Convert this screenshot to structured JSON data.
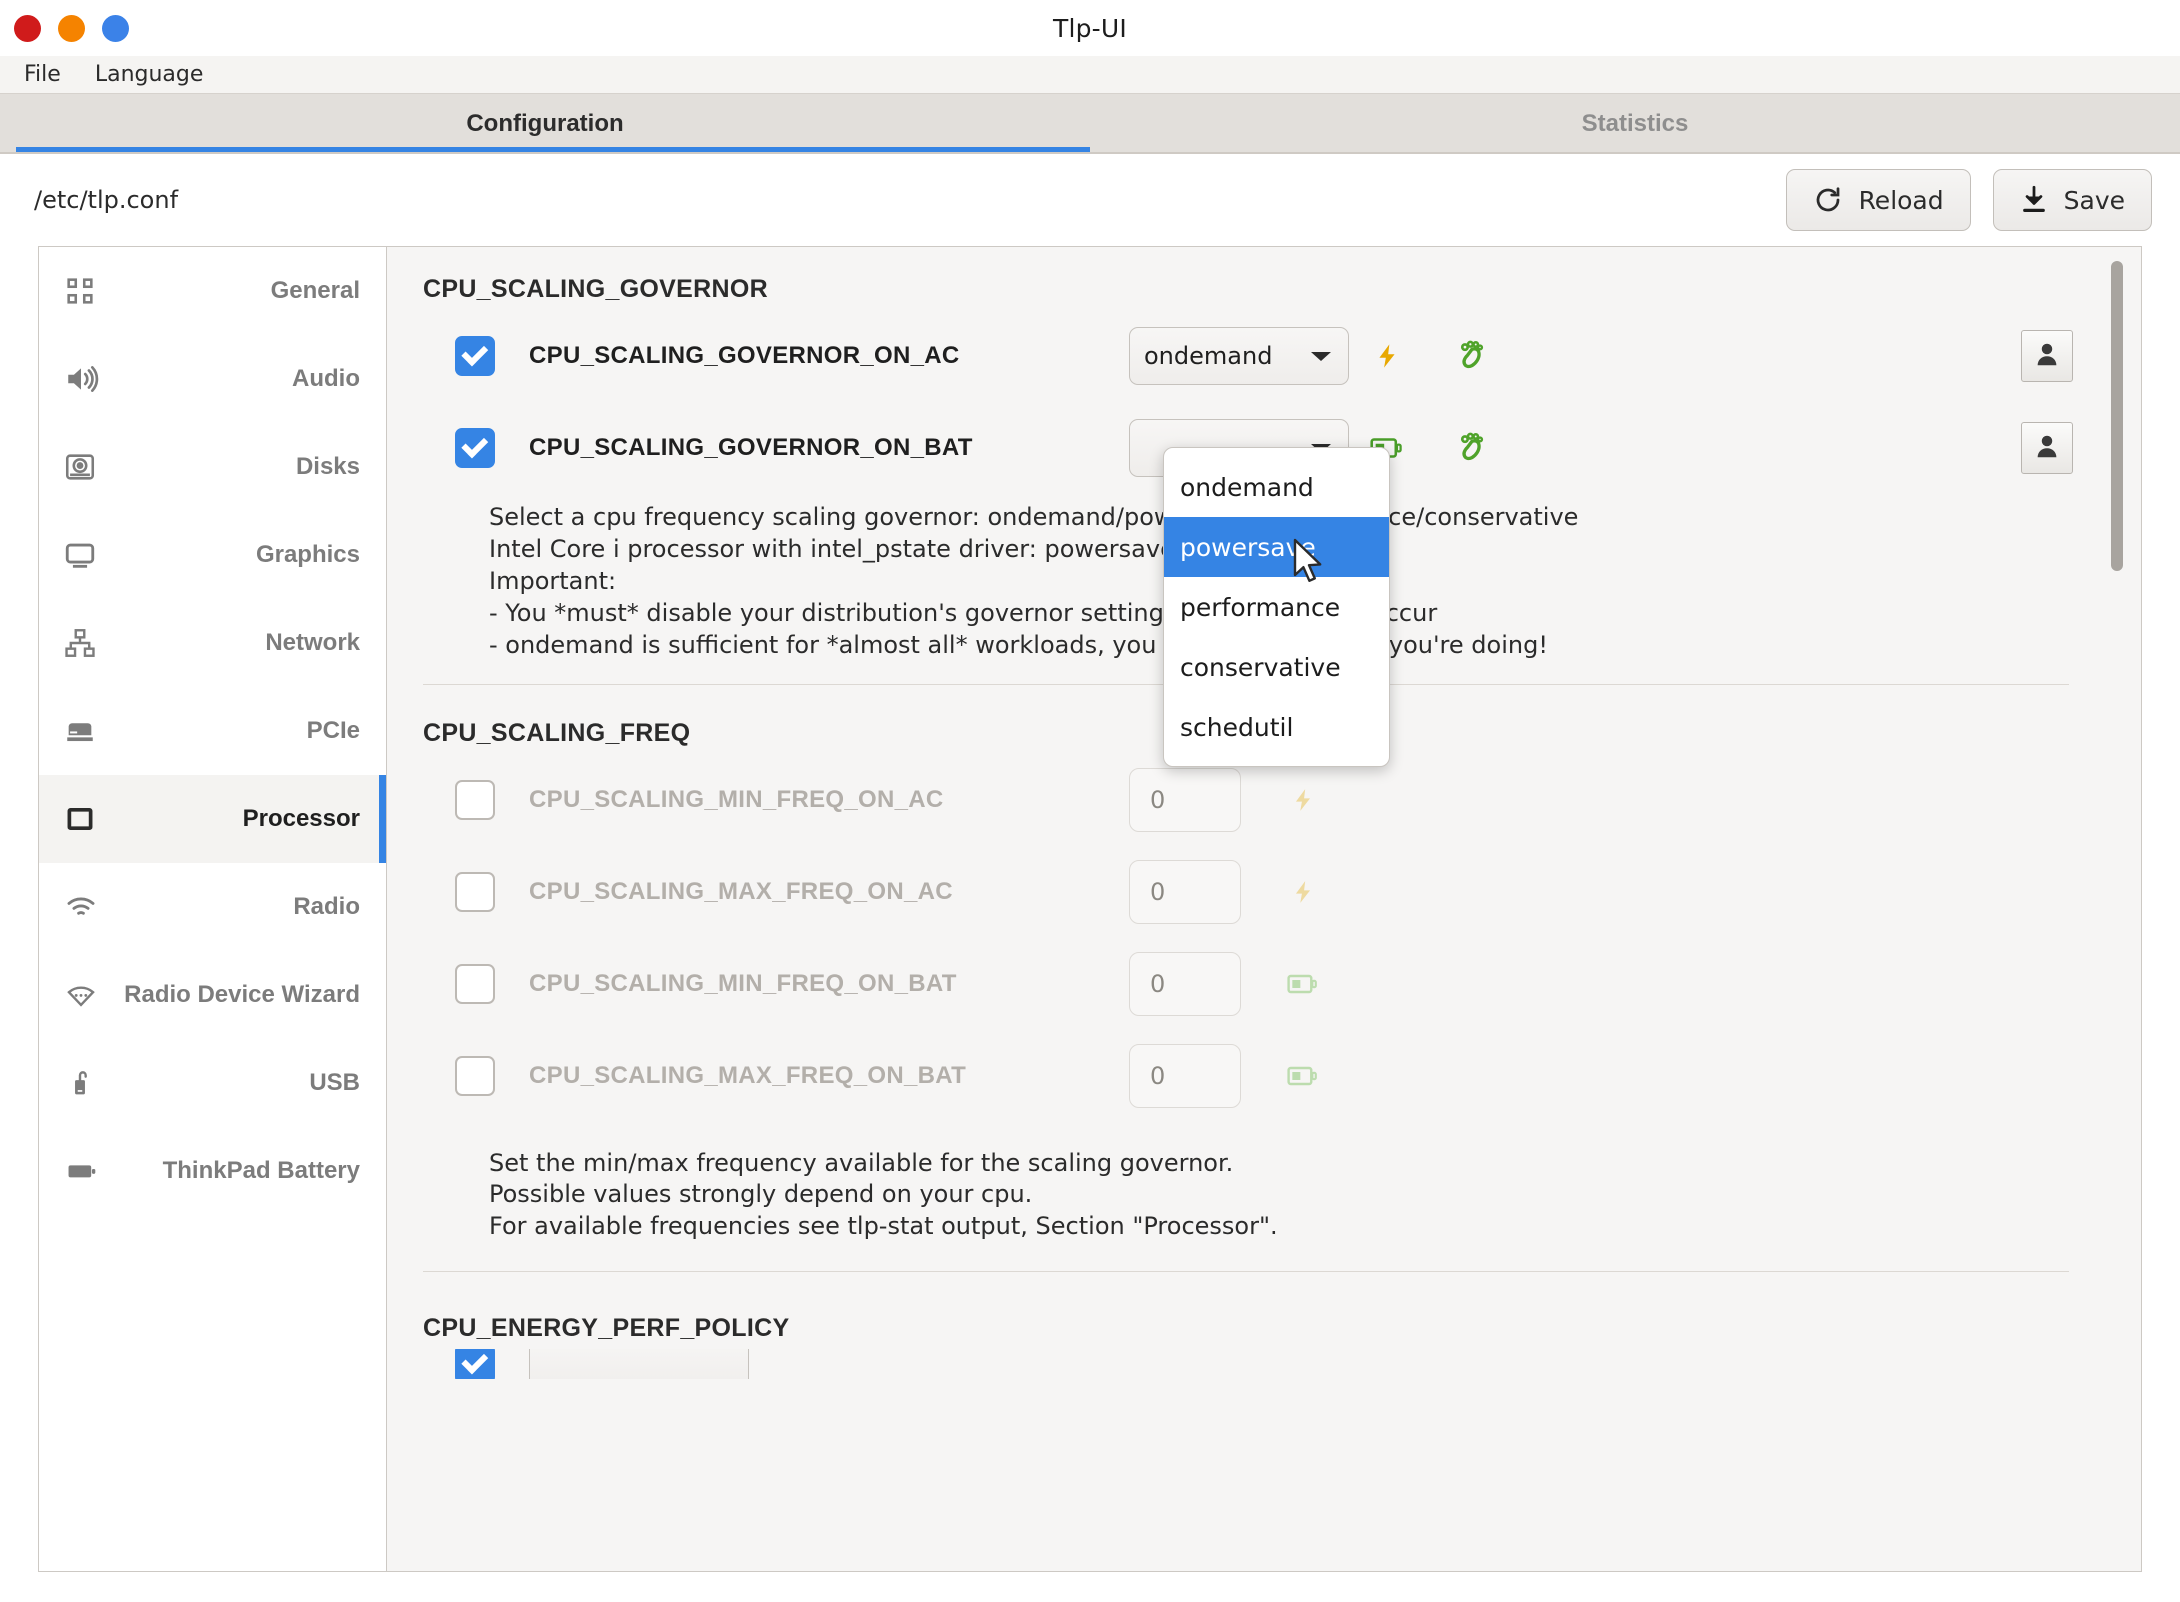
{
  "window": {
    "title": "Tlp-UI"
  },
  "titlebar_buttons": [
    {
      "name": "close",
      "color": "#d01b1b"
    },
    {
      "name": "minimize",
      "color": "#f58300"
    },
    {
      "name": "maximize",
      "color": "#3b82e8"
    }
  ],
  "menubar": {
    "items": [
      {
        "label": "File"
      },
      {
        "label": "Language"
      }
    ]
  },
  "tabs": [
    {
      "label": "Configuration",
      "active": true
    },
    {
      "label": "Statistics",
      "active": false
    }
  ],
  "toolbar": {
    "config_path": "/etc/tlp.conf",
    "reload_label": "Reload",
    "save_label": "Save"
  },
  "sidebar": {
    "items": [
      {
        "label": "General",
        "icon": "grid-icon",
        "selected": false
      },
      {
        "label": "Audio",
        "icon": "speaker-icon",
        "selected": false
      },
      {
        "label": "Disks",
        "icon": "harddisk-icon",
        "selected": false
      },
      {
        "label": "Graphics",
        "icon": "monitor-icon",
        "selected": false
      },
      {
        "label": "Network",
        "icon": "network-icon",
        "selected": false
      },
      {
        "label": "PCIe",
        "icon": "pcie-card-icon",
        "selected": false
      },
      {
        "label": "Processor",
        "icon": "cpu-icon",
        "selected": true
      },
      {
        "label": "Radio",
        "icon": "wifi-icon",
        "selected": false
      },
      {
        "label": "Radio Device Wizard",
        "icon": "wifi-wizard-icon",
        "selected": false
      },
      {
        "label": "USB",
        "icon": "usb-icon",
        "selected": false
      },
      {
        "label": "ThinkPad Battery",
        "icon": "battery-icon",
        "selected": false
      }
    ]
  },
  "sections": [
    {
      "title": "CPU_SCALING_GOVERNOR",
      "rows": [
        {
          "name": "CPU_SCALING_GOVERNOR_ON_AC",
          "checked": true,
          "control": "combo",
          "value": "ondemand",
          "power_icon": "ac-bolt-icon",
          "brand_icon": "gnome-foot-icon",
          "avatar": true
        },
        {
          "name": "CPU_SCALING_GOVERNOR_ON_BAT",
          "checked": true,
          "control": "combo",
          "value": "",
          "power_icon": "battery-icon",
          "brand_icon": "gnome-foot-icon",
          "avatar": true
        }
      ],
      "description": "Select a cpu frequency scaling governor: ondemand/powersave/performance/conservative\nIntel Core i processor with intel_pstate driver: powersave/performance\nImportant:\n- You *must* disable your distribution's governor settings or conflicts will occur\n- ondemand is sufficient for *almost all* workloads, you should know what you're doing!"
    },
    {
      "title": "CPU_SCALING_FREQ",
      "rows": [
        {
          "name": "CPU_SCALING_MIN_FREQ_ON_AC",
          "checked": false,
          "control": "number",
          "value": "0",
          "power_icon": "ac-bolt-icon"
        },
        {
          "name": "CPU_SCALING_MAX_FREQ_ON_AC",
          "checked": false,
          "control": "number",
          "value": "0",
          "power_icon": "ac-bolt-icon"
        },
        {
          "name": "CPU_SCALING_MIN_FREQ_ON_BAT",
          "checked": false,
          "control": "number",
          "value": "0",
          "power_icon": "battery-icon"
        },
        {
          "name": "CPU_SCALING_MAX_FREQ_ON_BAT",
          "checked": false,
          "control": "number",
          "value": "0",
          "power_icon": "battery-icon"
        }
      ],
      "description": "Set the min/max frequency available for the scaling governor.\nPossible values strongly depend on your cpu.\nFor available frequencies see tlp-stat output, Section \"Processor\"."
    },
    {
      "title": "CPU_ENERGY_PERF_POLICY",
      "rows": [],
      "description": ""
    }
  ],
  "dropdown": {
    "open": true,
    "options": [
      {
        "label": "ondemand",
        "highlighted": false
      },
      {
        "label": "powersave",
        "highlighted": true
      },
      {
        "label": "performance",
        "highlighted": false
      },
      {
        "label": "conservative",
        "highlighted": false
      },
      {
        "label": "schedutil",
        "highlighted": false
      }
    ]
  },
  "colors": {
    "accent": "#3584e4",
    "ac_icon": "#e8a800",
    "battery_icon": "#4a9e29",
    "gnome_green": "#4fa32a",
    "panel_bg": "#f6f5f4",
    "tabbar_bg": "#e2dfdb"
  }
}
